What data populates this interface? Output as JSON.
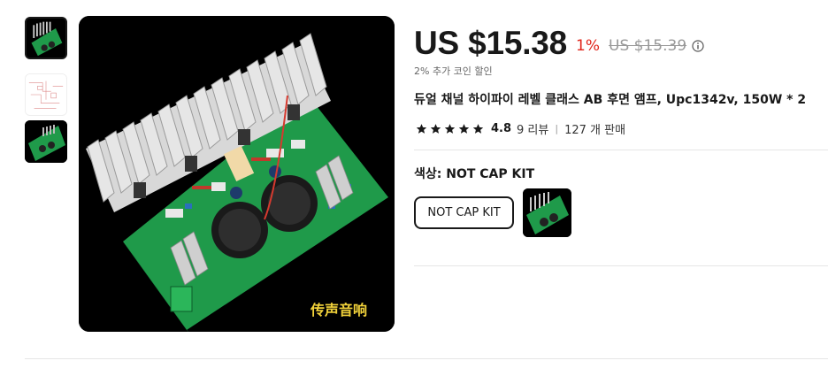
{
  "gallery": {
    "thumbnails": [
      {
        "name": "board-photo-1",
        "active": true
      },
      {
        "name": "schematic",
        "active": false
      },
      {
        "name": "board-photo-2",
        "active": false
      }
    ],
    "main_image_caption": "传声音响"
  },
  "price": {
    "current": "US $15.38",
    "discount": "1%",
    "original": "US $15.39",
    "coin_note": "2% 추가 코인 할인"
  },
  "product": {
    "title": "듀얼 채널 하이파이 레벨 클래스 AB 후면 앰프, Upc1342v, 150W * 2",
    "rating": "4.8",
    "stars": 5,
    "reviews": "9 리뷰",
    "sold": "127 개 판매"
  },
  "options": {
    "color_label": "색상: NOT CAP KIT",
    "selected": "NOT CAP KIT"
  },
  "colors": {
    "accent_red": "#e1251b",
    "pcb_green": "#1f9a4a",
    "text": "#191919"
  }
}
